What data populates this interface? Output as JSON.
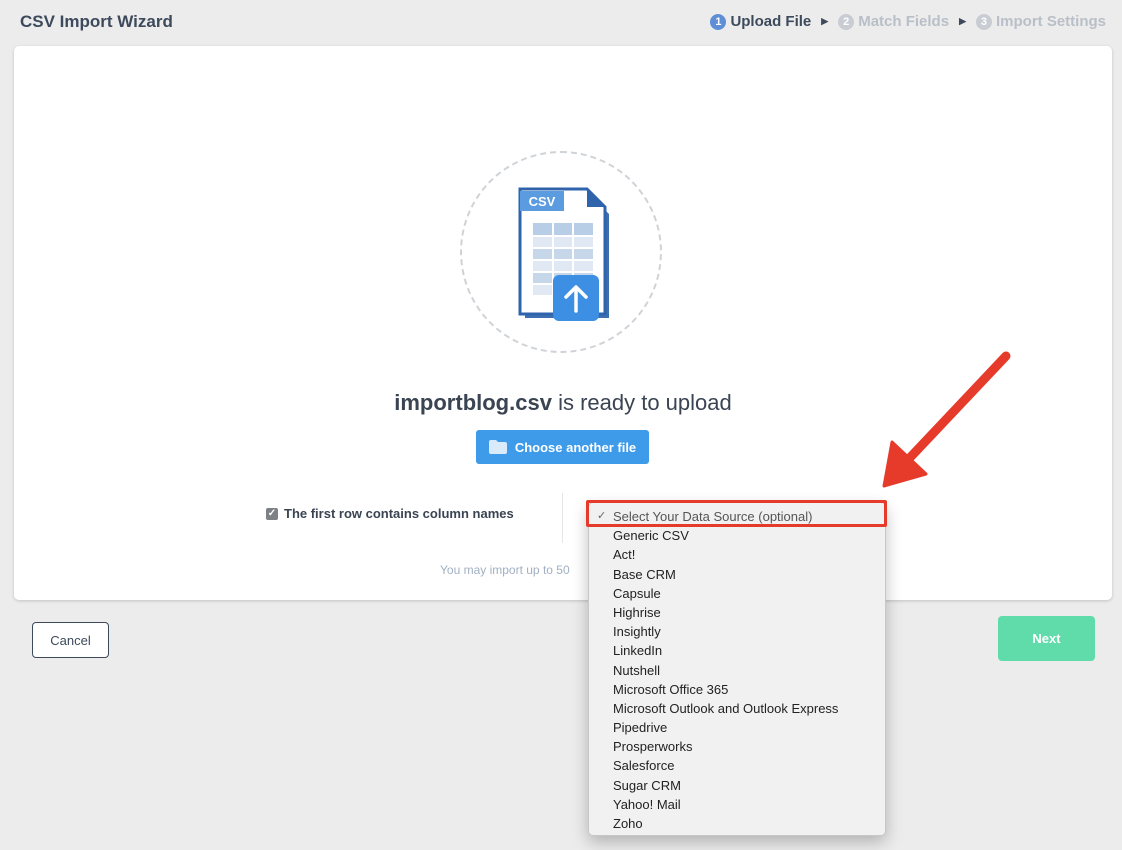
{
  "app": {
    "title": "CSV Import Wizard"
  },
  "steps": [
    {
      "num": "1",
      "label": "Upload File",
      "active": true
    },
    {
      "num": "2",
      "label": "Match Fields",
      "active": false
    },
    {
      "num": "3",
      "label": "Import Settings",
      "active": false
    }
  ],
  "upload": {
    "file_badge": "CSV",
    "filename": "importblog.csv",
    "ready_suffix": "is ready to upload",
    "choose_label": "Choose another file",
    "first_row_label": "The first row contains column names",
    "first_row_checked": true,
    "limit_text": "You may import up to 50"
  },
  "footer": {
    "cancel_label": "Cancel",
    "next_label": "Next"
  },
  "data_source": {
    "selected": "Select Your Data Source (optional)",
    "options": [
      "Generic CSV",
      "Act!",
      "Base CRM",
      "Capsule",
      "Highrise",
      "Insightly",
      "LinkedIn",
      "Nutshell",
      "Microsoft Office 365",
      "Microsoft Outlook and Outlook Express",
      "Pipedrive",
      "Prosperworks",
      "Salesforce",
      "Sugar CRM",
      "Yahoo! Mail",
      "Zoho"
    ]
  },
  "colors": {
    "primary": "#3d9be9",
    "next": "#5fdcaa",
    "highlight": "#e63a2a",
    "step_active": "#5e8fd6"
  }
}
